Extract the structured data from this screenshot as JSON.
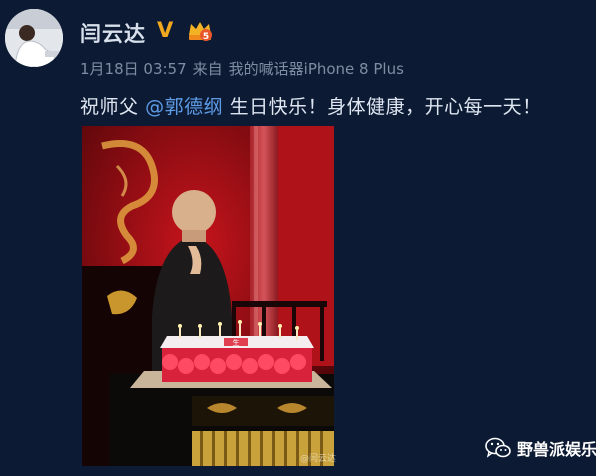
{
  "post": {
    "username": "闫云达",
    "date": "1月18日 03:57",
    "source_prefix": "来自",
    "source_device": "我的喊话器iPhone 8 Plus",
    "text_before": "祝师父",
    "mention": "@郭德纲",
    "text_after": " 生日快乐！身体健康，开心每一天！",
    "vip_level": "5",
    "verified_badge": "V"
  },
  "photo": {
    "watermark": "@闫云达",
    "cake_label": "生"
  },
  "brand": {
    "name": "野兽派娱乐",
    "icon": "wechat-icon"
  },
  "colors": {
    "background": "#0c1b33",
    "mention": "#5f9de8",
    "verified": "#f2a81e"
  }
}
